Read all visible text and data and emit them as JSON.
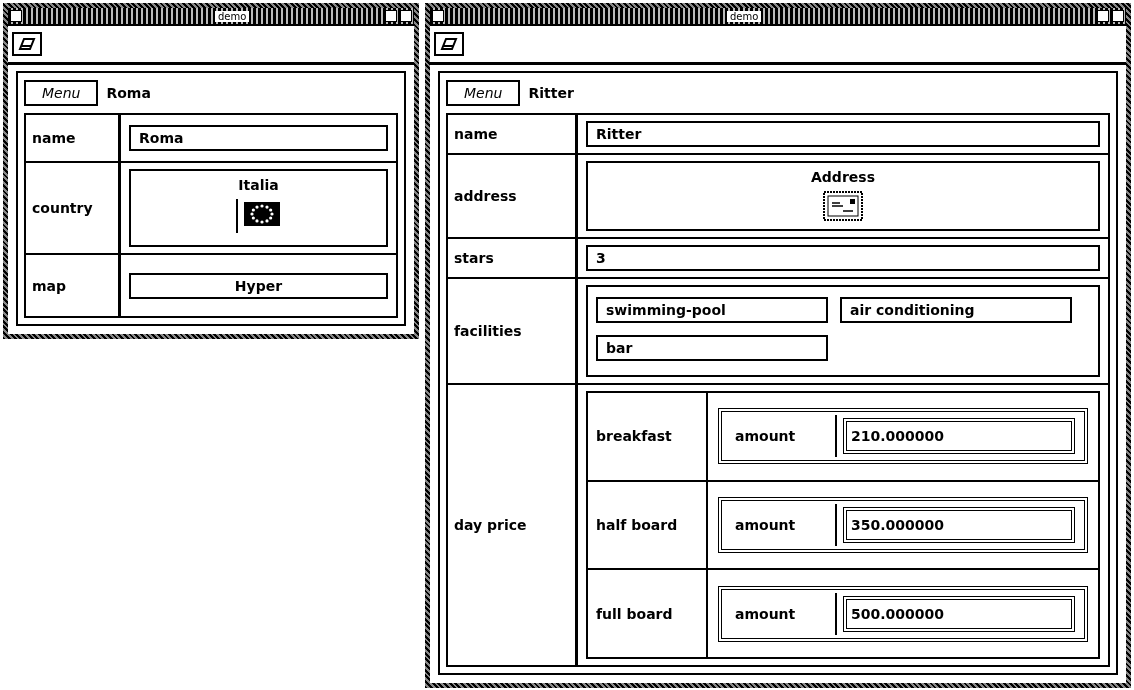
{
  "windows": [
    {
      "title": "demo",
      "menu": "Menu",
      "heading": "Roma",
      "rows": [
        {
          "kind": "text",
          "label": "name",
          "value": "Roma"
        },
        {
          "kind": "flag",
          "label": "country",
          "value": "Italia"
        },
        {
          "kind": "button",
          "label": "map",
          "value": "Hyper"
        }
      ]
    },
    {
      "title": "demo",
      "menu": "Menu",
      "heading": "Ritter",
      "rows": [
        {
          "kind": "text",
          "label": "name",
          "value": "Ritter"
        },
        {
          "kind": "envelope",
          "label": "address",
          "value": "Address"
        },
        {
          "kind": "text",
          "label": "stars",
          "value": "3"
        },
        {
          "kind": "list",
          "label": "facilities",
          "items": [
            "swimming-pool",
            "air conditioning",
            "bar"
          ]
        },
        {
          "kind": "table",
          "label": "day price",
          "items": [
            {
              "label": "breakfast",
              "field": "amount",
              "value": "210.000000"
            },
            {
              "label": "half board",
              "field": "amount",
              "value": "350.000000"
            },
            {
              "label": "full board",
              "field": "amount",
              "value": "500.000000"
            }
          ]
        }
      ]
    }
  ]
}
